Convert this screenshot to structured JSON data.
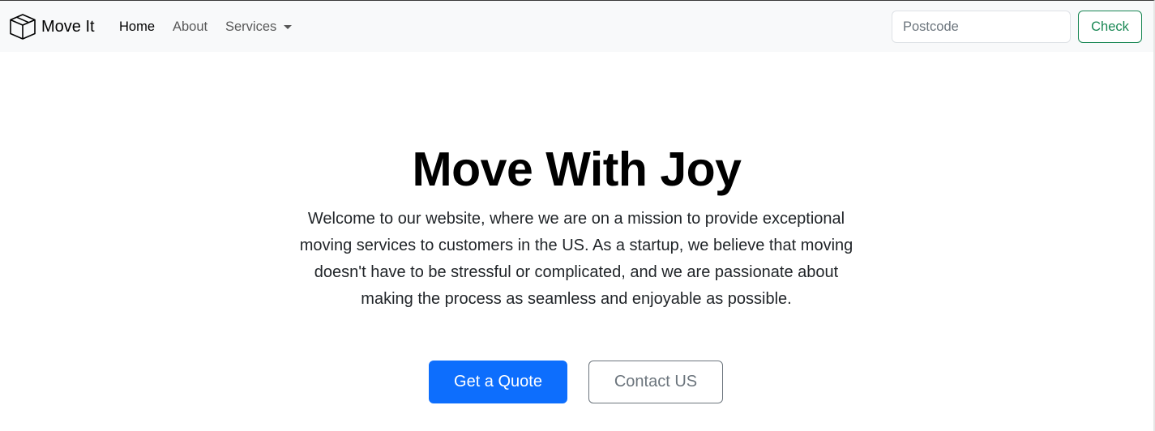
{
  "navbar": {
    "brand": {
      "name": "Move It",
      "icon": "box-icon"
    },
    "links": [
      {
        "label": "Home",
        "active": true
      },
      {
        "label": "About",
        "active": false
      },
      {
        "label": "Services",
        "active": false,
        "dropdown": true
      }
    ],
    "search": {
      "placeholder": "Postcode",
      "value": ""
    },
    "check_label": "Check"
  },
  "hero": {
    "title": "Move With Joy",
    "text": "Welcome to our website, where we are on a mission to provide exceptional moving services to customers in the US. As a startup, we believe that moving doesn't have to be stressful or complicated, and we are passionate about making the process as seamless and enjoyable as possible.",
    "primary_button": "Get a Quote",
    "secondary_button": "Contact US"
  },
  "colors": {
    "navbar_bg": "#f8f9fa",
    "primary": "#0d6efd",
    "success": "#198754",
    "secondary": "#6c757d"
  }
}
